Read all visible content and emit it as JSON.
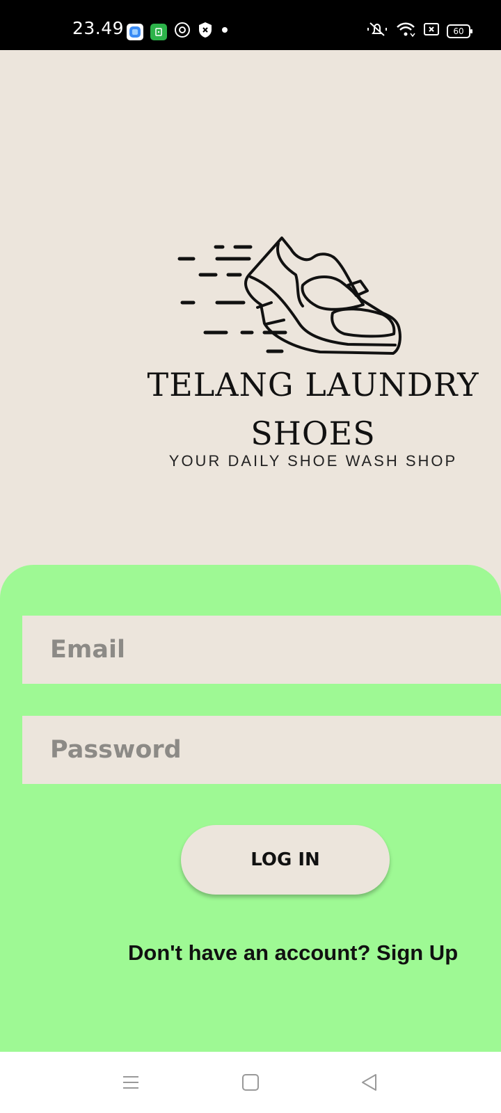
{
  "status_bar": {
    "time": "23.49",
    "battery": "60"
  },
  "brand": {
    "title_line1": "TELANG LAUNDRY",
    "title_line2": "SHOES",
    "subtitle": "YOUR DAILY SHOE WASH SHOP"
  },
  "form": {
    "email_placeholder": "Email",
    "password_placeholder": "Password",
    "login_label": "LOG IN",
    "signup_prompt": "Don't have an account? ",
    "signup_link": "Sign Up"
  },
  "colors": {
    "background": "#ece5dc",
    "panel": "#9ef994",
    "status_bar": "#000000"
  },
  "icons": [
    "app-icon-blue",
    "app-icon-green",
    "sync-icon",
    "shield-icon",
    "dot-icon",
    "mute-icon",
    "wifi-icon",
    "sim-icon",
    "battery-icon",
    "menu-icon",
    "home-icon",
    "back-icon"
  ]
}
